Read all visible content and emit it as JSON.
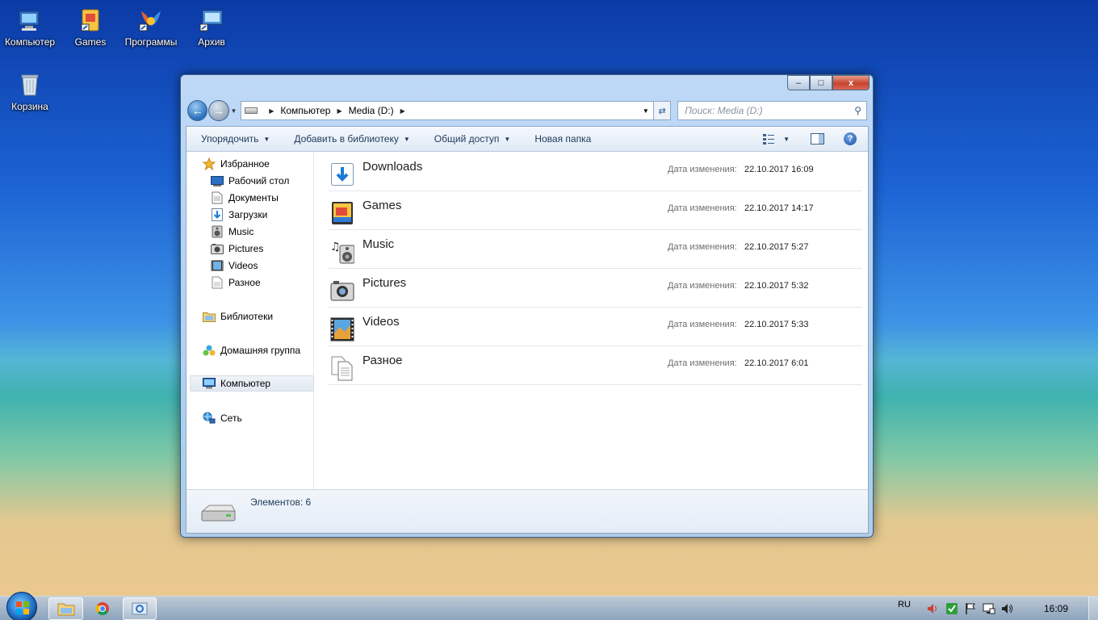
{
  "desktop": {
    "icons": [
      {
        "label": "Компьютер"
      },
      {
        "label": "Games"
      },
      {
        "label": "Программы"
      },
      {
        "label": "Архив"
      },
      {
        "label": "Корзина"
      }
    ]
  },
  "window": {
    "controls": {
      "minimize": "–",
      "maximize": "□",
      "close": "x"
    },
    "address": {
      "segments": [
        "Компьютер",
        "Media (D:)"
      ]
    },
    "search": {
      "placeholder": "Поиск: Media (D:)"
    },
    "toolbar": {
      "organize": "Упорядочить",
      "add_to_library": "Добавить в библиотеку",
      "share": "Общий доступ",
      "new_folder": "Новая папка",
      "help": "?"
    },
    "sidebar": {
      "favorites": "Избранное",
      "favorite_items": [
        "Рабочий стол",
        "Документы",
        "Загрузки",
        "Music",
        "Pictures",
        "Videos",
        "Разное"
      ],
      "libraries": "Библиотеки",
      "homegroup": "Домашняя группа",
      "computer": "Компьютер",
      "network": "Сеть"
    },
    "files": {
      "date_label": "Дата изменения:",
      "items": [
        {
          "name": "Downloads",
          "modified": "22.10.2017 16:09"
        },
        {
          "name": "Games",
          "modified": "22.10.2017 14:17"
        },
        {
          "name": "Music",
          "modified": "22.10.2017 5:27"
        },
        {
          "name": "Pictures",
          "modified": "22.10.2017 5:32"
        },
        {
          "name": "Videos",
          "modified": "22.10.2017 5:33"
        },
        {
          "name": "Разное",
          "modified": "22.10.2017 6:01"
        }
      ]
    },
    "status": {
      "count": "Элементов: 6"
    }
  },
  "taskbar": {
    "language": "RU",
    "clock": "16:09"
  }
}
